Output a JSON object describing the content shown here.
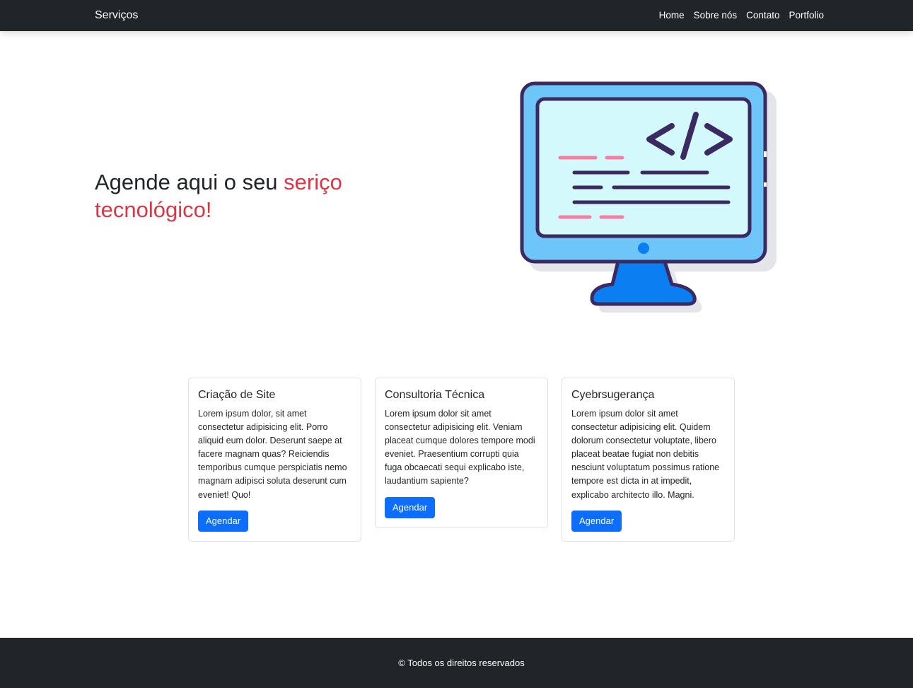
{
  "navbar": {
    "brand": "Serviços",
    "links": [
      "Home",
      "Sobre nós",
      "Contato",
      "Portfolio"
    ]
  },
  "hero": {
    "title_plain": "Agende aqui o seu ",
    "title_accent": "seriço tecnológico!",
    "illustration_icon": "code-monitor-icon"
  },
  "cards": [
    {
      "title": "Criação de Site",
      "text": "Lorem ipsum dolor, sit amet consectetur adipisicing elit. Porro aliquid eum dolor. Deserunt saepe at facere magnam quas? Reiciendis temporibus cumque perspiciatis nemo magnam adipisci soluta deserunt cum eveniet! Quo!",
      "button": "Agendar"
    },
    {
      "title": "Consultoria Técnica",
      "text": "Lorem ipsum dolor sit amet consectetur adipisicing elit. Veniam placeat cumque dolores tempore modi eveniet. Praesentium corrupti quia fuga obcaecati sequi explicabo iste, laudantium sapiente?",
      "button": "Agendar"
    },
    {
      "title": "Cyebrsugerança",
      "text": "Lorem ipsum dolor sit amet consectetur adipisicing elit. Quidem dolorum consectetur voluptate, libero placeat beatae fugiat non debitis nesciunt voluptatum possimus ratione tempore est dicta in at impedit, explicabo architecto illo. Magni.",
      "button": "Agendar"
    }
  ],
  "footer": {
    "text": "© Todos os direitos reservados"
  },
  "colors": {
    "navbar_bg": "#212529",
    "accent": "#dc3545",
    "primary_button": "#0d6efd",
    "monitor_frame": "#6ec6f8",
    "monitor_screen": "#d4f9fd",
    "monitor_stand": "#0b7ef1",
    "outline": "#3b2a62",
    "code_pink": "#f47fa0"
  }
}
